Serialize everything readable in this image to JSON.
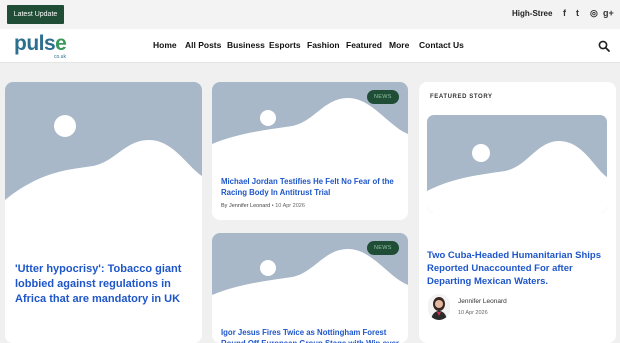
{
  "topbar": {
    "latest_label": "Latest Update",
    "ticker_text": "High-Stree",
    "social": [
      {
        "name": "facebook-icon",
        "glyph": "f"
      },
      {
        "name": "twitter-icon",
        "glyph": "t"
      },
      {
        "name": "instagram-icon",
        "glyph": "◎"
      },
      {
        "name": "google-plus-icon",
        "glyph": "g+"
      }
    ]
  },
  "logo": {
    "word_main": "puls",
    "word_accent": "e",
    "sub": "co.uk"
  },
  "nav": {
    "items": [
      "Home",
      "All Posts",
      "Business",
      "Esports",
      "Fashion",
      "Featured",
      "More",
      "Contact Us"
    ]
  },
  "articles": {
    "main": {
      "title": "'Utter hypocrisy': Tobacco giant lobbied against regulations in Africa that are mandatory in UK"
    },
    "jordan": {
      "badge": "NEWS",
      "title": "Michael Jordan Testifies He Felt No Fear of the Racing Body In Antitrust Trial",
      "author": "By Jennifer Leonard",
      "date": "10 Apr 2026"
    },
    "igor": {
      "badge": "NEWS",
      "title": "Igor Jesus Fires Twice as Nottingham Forest Round Off European Group Stage with Win over"
    }
  },
  "featured": {
    "heading": "FEATURED STORY",
    "title": "Two Cuba-Headed Humanitarian Ships Reported Unaccounted For after Departing Mexican Waters.",
    "author": "Jennifer Leonard",
    "date": "10 Apr 2026"
  },
  "colors": {
    "brand_green": "#1f4d35",
    "link_blue": "#1e56c9",
    "placeholder": "#a8b8c8"
  }
}
